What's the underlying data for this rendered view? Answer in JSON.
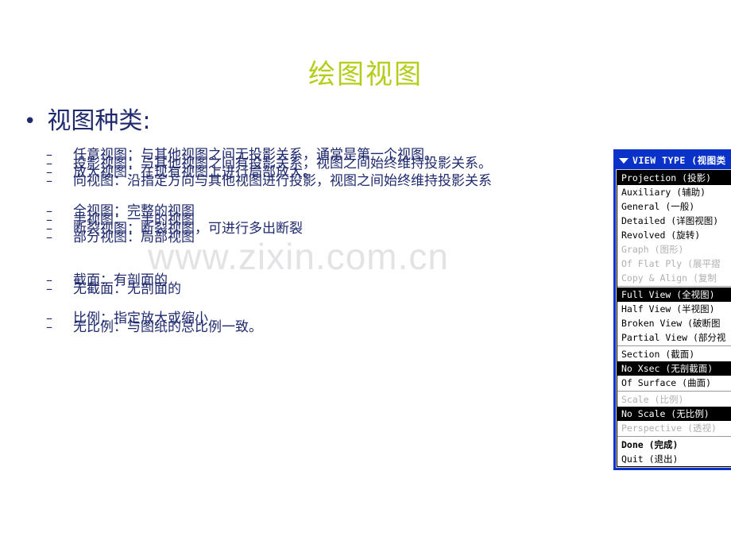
{
  "slide": {
    "title": "绘图视图",
    "title_color": "#b5cc18",
    "text_color": "#1f2a6e",
    "background": "#ffffff"
  },
  "watermark": {
    "text": "www.zixin.com.cn",
    "color": "#e3e3e6"
  },
  "outline": {
    "level1": {
      "bullet": "•",
      "label": "视图种类:"
    },
    "groups": [
      {
        "items": [
          {
            "dash": "–",
            "text": "任意视图：与其他视图之间无投影关系，通常是第一个视图。"
          },
          {
            "dash": "–",
            "text": "投影视图：与其他视图之间有投影关系，视图之间始终维持投影关系。"
          },
          {
            "dash": "–",
            "text": "放大视图：在现有视图上进行局部放大。"
          },
          {
            "dash": "–",
            "text": "向视图：沿指定方向与其他视图进行投影，视图之间始终维持投影关系"
          }
        ]
      },
      {
        "items": [
          {
            "dash": "–",
            "text": "全视图：完整的视图"
          },
          {
            "dash": "–",
            "text": "半视图：一半的视图"
          },
          {
            "dash": "–",
            "text": "断裂视图：断裂视图，可进行多出断裂"
          },
          {
            "dash": "–",
            "text": "部分视图：局部视图"
          }
        ]
      },
      {
        "items": [
          {
            "dash": "–",
            "text": "截面：有剖面的"
          },
          {
            "dash": "–",
            "text": "无截面：无剖面的"
          }
        ]
      },
      {
        "items": [
          {
            "dash": "–",
            "text": "比例：指定放大或缩小"
          },
          {
            "dash": "–",
            "text": "无比例：与图纸的总比例一致。"
          }
        ]
      }
    ]
  },
  "menu": {
    "header": {
      "icon": "triangle-down-icon",
      "label": "VIEW TYPE (视图类"
    },
    "header_bg": "#0a32c8",
    "selected_bg": "#000000",
    "items": [
      {
        "label": "Projection (投影)",
        "state": "selected"
      },
      {
        "label": "Auxiliary (辅助)",
        "state": "normal"
      },
      {
        "label": "General (一般)",
        "state": "normal"
      },
      {
        "label": "Detailed (详图视图)",
        "state": "normal"
      },
      {
        "label": "Revolved (旋转)",
        "state": "normal"
      },
      {
        "label": "Graph (图形)",
        "state": "disabled"
      },
      {
        "label": "Of Flat Ply (展平摺",
        "state": "disabled"
      },
      {
        "label": "Copy & Align (复制",
        "state": "disabled"
      },
      {
        "separator": true
      },
      {
        "label": "Full View (全视图)",
        "state": "selected"
      },
      {
        "label": "Half View (半视图)",
        "state": "normal"
      },
      {
        "label": "Broken View (破断图",
        "state": "normal"
      },
      {
        "label": "Partial View (部分视",
        "state": "normal"
      },
      {
        "separator": true
      },
      {
        "label": "Section (截面)",
        "state": "normal"
      },
      {
        "label": "No Xsec (无剖截面)",
        "state": "selected"
      },
      {
        "label": "Of Surface (曲面)",
        "state": "normal"
      },
      {
        "separator": true
      },
      {
        "label": "Scale (比例)",
        "state": "disabled"
      },
      {
        "label": "No Scale (无比例)",
        "state": "selected"
      },
      {
        "label": "Perspective (透视)",
        "state": "disabled"
      },
      {
        "separator": true
      },
      {
        "label": "Done (完成)",
        "state": "bold"
      },
      {
        "label": "Quit (退出)",
        "state": "normal"
      }
    ]
  }
}
